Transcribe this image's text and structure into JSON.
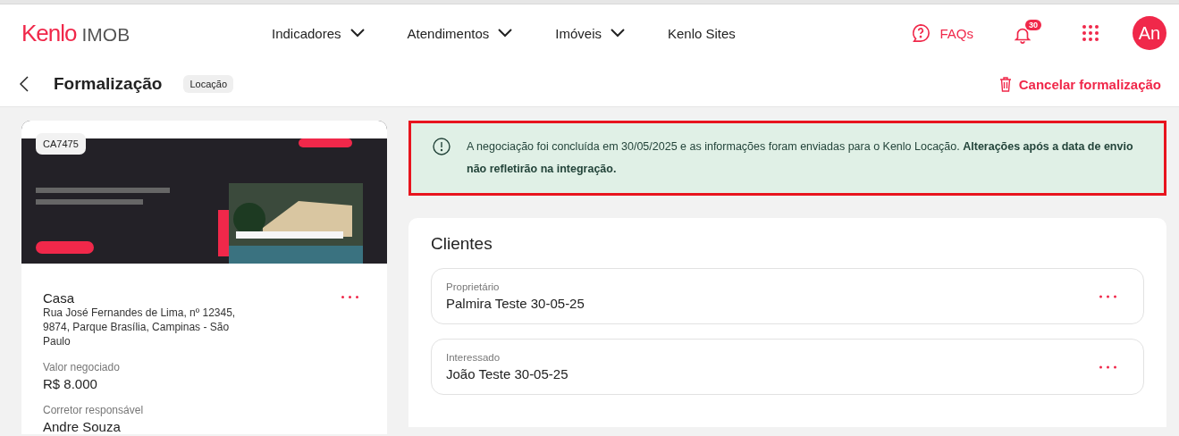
{
  "header": {
    "logo": {
      "brand": "Kenlo",
      "product": "IMOB"
    },
    "nav": [
      {
        "label": "Indicadores",
        "has_menu": true
      },
      {
        "label": "Atendimentos",
        "has_menu": true
      },
      {
        "label": "Imóveis",
        "has_menu": true
      },
      {
        "label": "Kenlo Sites",
        "has_menu": false
      }
    ],
    "faqs": "FAQs",
    "notifications": "30",
    "avatar": "An"
  },
  "page": {
    "title": "Formalização",
    "tag": "Locação",
    "cancel": "Cancelar formalização"
  },
  "property": {
    "code": "CA7475",
    "type": "Casa",
    "address": "Rua José Fernandes de Lima, nº 12345, 9874, Parque Brasília, Campinas - São Paulo",
    "fields": [
      {
        "label": "Valor negociado",
        "value": "R$ 8.000"
      },
      {
        "label": "Corretor responsável",
        "value": "Andre Souza"
      }
    ]
  },
  "alert": {
    "text": "A negociação foi concluída em 30/05/2025 e as informações foram enviadas para o Kenlo Locação. **Alterações após a data de envio não refletirão na integração.**"
  },
  "clients": {
    "title": "Clientes",
    "items": [
      {
        "role": "Proprietário",
        "name": "Palmira Teste 30-05-25"
      },
      {
        "role": "Interessado",
        "name": "João Teste 30-05-25"
      }
    ]
  }
}
